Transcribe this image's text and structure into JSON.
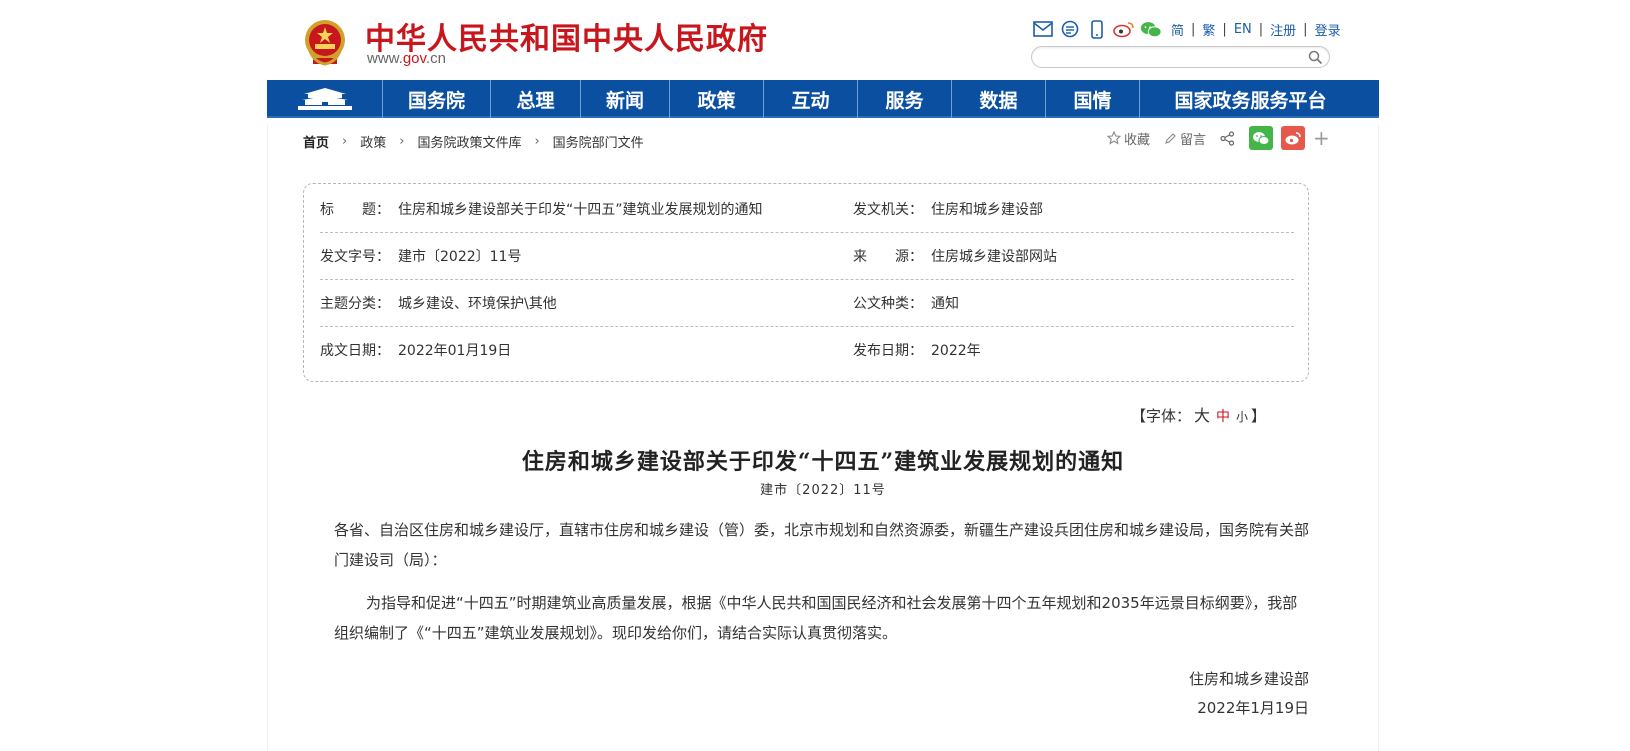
{
  "header": {
    "site_title": "中华人民共和国中央人民政府",
    "domain_prefix": "www.",
    "domain_main": "gov",
    "domain_suffix": ".cn",
    "tool_icons": [
      "mail-icon",
      "rss-icon",
      "mobile-icon",
      "weibo-icon",
      "wechat-icon"
    ],
    "links": [
      "简",
      "繁",
      "EN",
      "注册",
      "登录"
    ],
    "search_placeholder": ""
  },
  "nav": {
    "items": [
      "国务院",
      "总理",
      "新闻",
      "政策",
      "互动",
      "服务",
      "数据",
      "国情",
      "国家政务服务平台"
    ]
  },
  "breadcrumb": [
    "首页",
    "政策",
    "国务院政策文件库",
    "国务院部门文件"
  ],
  "share": {
    "favorite": "收藏",
    "comment": "留言"
  },
  "info": {
    "title_label": "标　　题：",
    "title_value": "住房和城乡建设部关于印发“十四五”建筑业发展规划的通知",
    "issuer_label": "发文机关：",
    "issuer_value": "住房和城乡建设部",
    "docno_label": "发文字号：",
    "docno_value": "建市〔2022〕11号",
    "source_label": "来　　源：",
    "source_value": "住房城乡建设部网站",
    "topic_label": "主题分类：",
    "topic_value": "城乡建设、环境保护\\其他",
    "type_label": "公文种类：",
    "type_value": "通知",
    "written_label": "成文日期：",
    "written_value": "2022年01月19日",
    "published_label": "发布日期：",
    "published_value": "2022年"
  },
  "font_switch": {
    "prefix": "【字体：",
    "big": "大",
    "mid": "中",
    "small": "小",
    "suffix": "】"
  },
  "article": {
    "title": "住房和城乡建设部关于印发“十四五”建筑业发展规划的通知",
    "doc_number": "建市〔2022〕11号",
    "para1": "各省、自治区住房和城乡建设厅，直辖市住房和城乡建设（管）委，北京市规划和自然资源委，新疆生产建设兵团住房和城乡建设局，国务院有关部门建设司（局）：",
    "para2": "为指导和促进“十四五”时期建筑业高质量发展，根据《中华人民共和国国民经济和社会发展第十四个五年规划和2035年远景目标纲要》，我部组织编制了《“十四五”建筑业发展规划》。现印发给你们，请结合实际认真贯彻落实。",
    "signature_org": "住房和城乡建设部",
    "signature_date": "2022年1月19日"
  }
}
